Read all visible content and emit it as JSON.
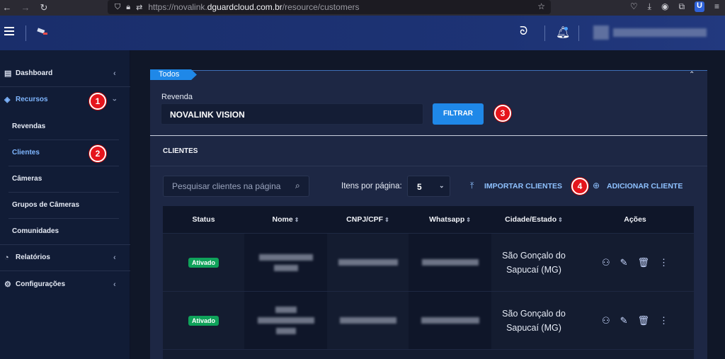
{
  "browser": {
    "url_prefix": "https://novalink.",
    "url_domain": "dguardcloud.com.br",
    "url_path": "/resource/customers"
  },
  "sidebar": {
    "items": [
      {
        "label": "Dashboard",
        "icon": "calendar-icon"
      },
      {
        "label": "Recursos",
        "icon": "layers-icon"
      },
      {
        "label": "Revendas"
      },
      {
        "label": "Clientes"
      },
      {
        "label": "Câmeras"
      },
      {
        "label": "Grupos de Câmeras"
      },
      {
        "label": "Comunidades"
      },
      {
        "label": "Relatórios",
        "icon": "pie-chart-icon"
      },
      {
        "label": "Configurações",
        "icon": "gear-icon"
      }
    ]
  },
  "filter": {
    "tag": "Todos",
    "revenda_label": "Revenda",
    "revenda_value": "NOVALINK VISION",
    "button": "FILTRAR"
  },
  "clients": {
    "title": "CLIENTES",
    "search_placeholder": "Pesquisar clientes na página",
    "items_per_page_label": "Itens por página:",
    "items_per_page_value": "5",
    "import_label": "IMPORTAR CLIENTES",
    "add_label": "ADICIONAR CLIENTE",
    "columns": [
      "Status",
      "Nome",
      "CNPJ/CPF",
      "Whatsapp",
      "Cidade/Estado",
      "Ações"
    ],
    "rows": [
      {
        "status": "Ativado",
        "city": "São Gonçalo do Sapucaí (MG)"
      },
      {
        "status": "Ativado",
        "city": "São Gonçalo do Sapucaí (MG)"
      }
    ]
  },
  "annotations": [
    "1",
    "2",
    "3",
    "4"
  ],
  "colors": {
    "accent": "#1f88e8",
    "active_link": "#7fb6ff",
    "status_active": "#0fa25a",
    "marker": "#e5151c"
  }
}
